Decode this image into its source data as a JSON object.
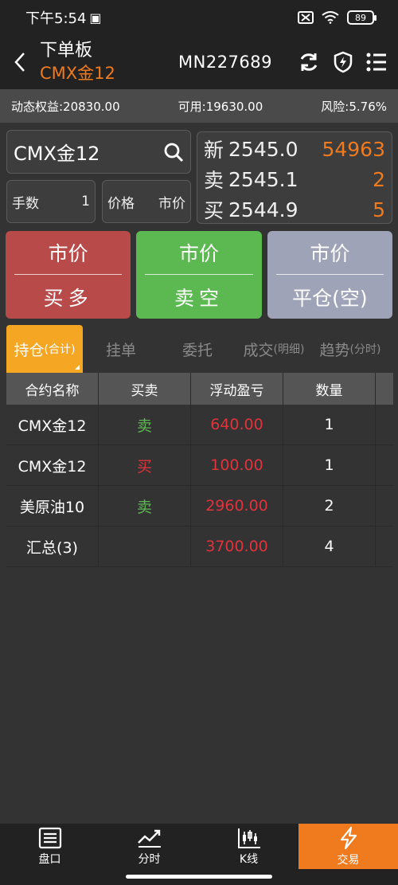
{
  "status_bar": {
    "time": "下午5:54",
    "battery": "89"
  },
  "header": {
    "title": "下单板",
    "subtitle": "CMX金12",
    "account": "MN227689"
  },
  "info": {
    "equity": "动态权益:20830.00",
    "available": "可用:19630.00",
    "risk": "风险:5.76%"
  },
  "search": {
    "value": "CMX金12"
  },
  "fields": {
    "qty_label": "手数",
    "qty_value": "1",
    "price_label": "价格",
    "price_value": "市价"
  },
  "quotes": [
    {
      "label": "新",
      "price": "2545.0",
      "volume": "54963"
    },
    {
      "label": "卖",
      "price": "2545.1",
      "volume": "2"
    },
    {
      "label": "买",
      "price": "2544.9",
      "volume": "5"
    }
  ],
  "actions": {
    "buy": {
      "top": "市价",
      "bottom": "买多"
    },
    "sell": {
      "top": "市价",
      "bottom": "卖空"
    },
    "close": {
      "top": "市价",
      "bottom": "平仓(空)"
    }
  },
  "tabs": [
    {
      "label": "持仓",
      "sub": "(合计)"
    },
    {
      "label": "挂单",
      "sub": ""
    },
    {
      "label": "委托",
      "sub": ""
    },
    {
      "label": "成交",
      "sub": "(明细)"
    },
    {
      "label": "趋势",
      "sub": "(分时)"
    }
  ],
  "table": {
    "headers": [
      "合约名称",
      "买卖",
      "浮动盈亏",
      "数量"
    ],
    "rows": [
      {
        "name": "CMX金12",
        "side": "卖",
        "pnl": "640.00",
        "qty": "1"
      },
      {
        "name": "CMX金12",
        "side": "买",
        "pnl": "100.00",
        "qty": "1"
      },
      {
        "name": "美原油10",
        "side": "卖",
        "pnl": "2960.00",
        "qty": "2"
      },
      {
        "name": "汇总(3)",
        "side": "",
        "pnl": "3700.00",
        "qty": "4"
      }
    ]
  },
  "bottom_nav": [
    {
      "label": "盘口",
      "icon": "orderbook-icon"
    },
    {
      "label": "分时",
      "icon": "timeshare-icon"
    },
    {
      "label": "K线",
      "icon": "candlestick-icon"
    },
    {
      "label": "交易",
      "icon": "lightning-icon"
    }
  ],
  "colors": {
    "accent": "#f07a1e",
    "buy": "#b84a4a",
    "sell": "#5cb851",
    "close": "#9ea3b8",
    "loss_text": "#e0333c"
  }
}
